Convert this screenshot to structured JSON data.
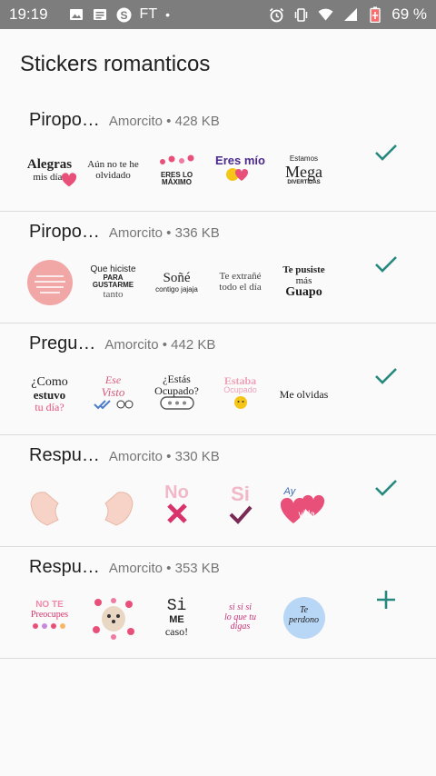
{
  "status_bar": {
    "time": "19:19",
    "carrier_text": "FT",
    "battery": "69 %",
    "left_icons": [
      "image-icon",
      "messages-icon",
      "skype-icon"
    ],
    "right_icons": [
      "alarm-icon",
      "vibrate-icon",
      "wifi-icon",
      "signal-icon",
      "battery-icon"
    ]
  },
  "app_bar": {
    "title": "Stickers romanticos"
  },
  "colors": {
    "accent": "#26897e",
    "status_bar": "#7d7d7d",
    "heart": "#e8507a"
  },
  "packs": [
    {
      "name": "Piropo…",
      "author": "Amorcito",
      "size": "428 KB",
      "separator": "•",
      "status": "added",
      "action_icon": "checkmark-icon",
      "stickers": [
        {
          "lines": [
            "Alegras",
            "mis días"
          ]
        },
        {
          "lines": [
            "Aún no te he",
            "olvidado"
          ]
        },
        {
          "lines": [
            "ERES LO MÁXIMO"
          ]
        },
        {
          "lines": [
            "Eres mío"
          ]
        },
        {
          "lines": [
            "Estamos",
            "Mega",
            "DIVERTIDAS"
          ]
        }
      ]
    },
    {
      "name": "Piropo…",
      "author": "Amorcito",
      "size": "336 KB",
      "separator": "•",
      "status": "added",
      "action_icon": "checkmark-icon",
      "stickers": [
        {
          "lines": []
        },
        {
          "lines": [
            "Que hiciste",
            "PARA GUSTARME",
            "tanto"
          ]
        },
        {
          "lines": [
            "Soñé",
            "contigo jajaja"
          ]
        },
        {
          "lines": [
            "Te extrañé",
            "todo el día"
          ]
        },
        {
          "lines": [
            "Te pusiste",
            "más",
            "Guapo"
          ]
        }
      ]
    },
    {
      "name": "Pregu…",
      "author": "Amorcito",
      "size": "442 KB",
      "separator": "•",
      "status": "added",
      "action_icon": "checkmark-icon",
      "stickers": [
        {
          "lines": [
            "¿Como",
            "estuvo",
            "tu día?"
          ]
        },
        {
          "lines": [
            "Ese",
            "Visto"
          ]
        },
        {
          "lines": [
            "¿Estás",
            "Ocupado?"
          ]
        },
        {
          "lines": [
            "Estaba",
            "Ocupado"
          ]
        },
        {
          "lines": [
            "Me olvidas"
          ]
        }
      ]
    },
    {
      "name": "Respu…",
      "author": "Amorcito",
      "size": "330 KB",
      "separator": "•",
      "status": "added",
      "action_icon": "checkmark-icon",
      "stickers": [
        {
          "lines": []
        },
        {
          "lines": []
        },
        {
          "lines": [
            "No"
          ]
        },
        {
          "lines": [
            "Si"
          ]
        },
        {
          "lines": [
            "Ay",
            "mi",
            "vida"
          ]
        }
      ]
    },
    {
      "name": "Respu…",
      "author": "Amorcito",
      "size": "353 KB",
      "separator": "•",
      "status": "not_added",
      "action_icon": "plus-icon",
      "stickers": [
        {
          "lines": [
            "NO TE",
            "Preocupes"
          ]
        },
        {
          "lines": []
        },
        {
          "lines": [
            "Si",
            "ME",
            "caso!"
          ]
        },
        {
          "lines": [
            "si si si",
            "lo que tu",
            "digas"
          ]
        },
        {
          "lines": [
            "Te",
            "perdono"
          ]
        }
      ]
    }
  ]
}
